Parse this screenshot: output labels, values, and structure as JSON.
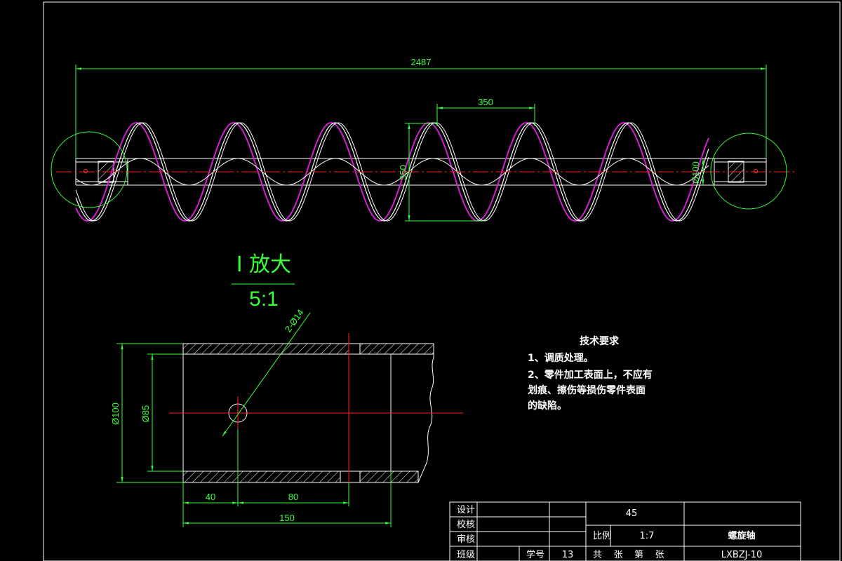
{
  "drawing": {
    "dimensions": {
      "overall_length": "2487",
      "pitch": "350",
      "flight_diameter": "350",
      "shaft_diameter": "Ø100",
      "detail_outer_diameter": "Ø100",
      "detail_inner_diameter": "Ø85",
      "hole_callout": "2-Ø14",
      "detail_len_40": "40",
      "detail_len_80": "80",
      "detail_len_150": "150"
    },
    "detail_label": {
      "title": "I 放大",
      "scale": "5:1"
    },
    "tech_requirements": {
      "heading": "技术要求",
      "line1": "1、调质处理。",
      "line2": "2、零件加工表面上，不应有",
      "line3": "划痕、擦伤等损伤零件表面",
      "line4": "的缺陷。"
    },
    "title_block": {
      "design": "设计",
      "check": "校核",
      "review": "审核",
      "class": "班级",
      "student_no_label": "学号",
      "student_no": "13",
      "material": "45",
      "scale_label": "比例",
      "scale_value": "1:7",
      "sheets": "共    张    第    张",
      "part_name": "螺旋轴",
      "drawing_no": "LXBZJ-10"
    }
  },
  "colors": {
    "background": "#000000",
    "outline": "#ffffff",
    "dimension": "#39ff39",
    "centerline": "#ff2020",
    "flight_edge": "#d020d0"
  }
}
